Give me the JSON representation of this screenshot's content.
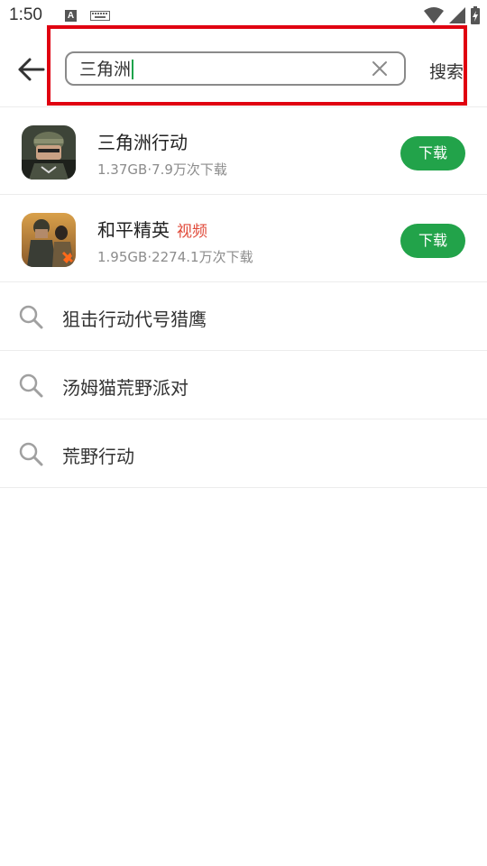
{
  "status_bar": {
    "time": "1:50",
    "icons": [
      "a-notification-icon",
      "keyboard-icon",
      "wifi-icon",
      "cellular-signal-icon",
      "battery-charging-icon"
    ]
  },
  "search": {
    "query": "三角洲",
    "clear_icon": "close-icon",
    "submit_label": "搜索"
  },
  "results": [
    {
      "name": "三角洲行动",
      "tag": "",
      "meta": "1.37GB·7.9万次下载",
      "button_label": "下载",
      "icon": "game-icon-delta-force"
    },
    {
      "name": "和平精英",
      "tag": "视频",
      "meta": "1.95GB·2274.1万次下载",
      "button_label": "下载",
      "icon": "game-icon-peacekeeper-elite"
    }
  ],
  "suggestions": [
    {
      "text": "狙击行动代号猎鹰",
      "icon": "search-icon"
    },
    {
      "text": "汤姆猫荒野派对",
      "icon": "search-icon"
    },
    {
      "text": "荒野行动",
      "icon": "search-icon"
    }
  ],
  "colors": {
    "accent_green": "#22a34a",
    "highlight_red": "#e00010",
    "tag_red": "#e04a3a",
    "caret_green": "#1aa34a"
  }
}
